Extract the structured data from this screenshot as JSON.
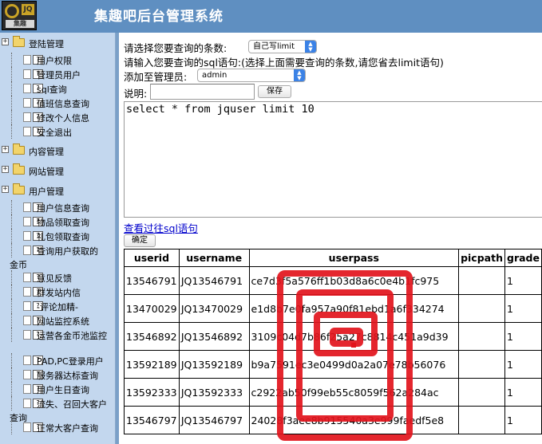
{
  "app": {
    "title": "集趣吧后台管理系统",
    "logo_badge": "JQ",
    "logo_sub": "集趣"
  },
  "sidebar": {
    "groups": [
      {
        "label": "登陆管理",
        "toggle": "+",
        "items": [
          "用户权限",
          "管理员用户",
          "sql查询",
          "值班信息查询",
          "修改个人信息",
          "安全退出"
        ]
      },
      {
        "label": "内容管理",
        "toggle": "+"
      },
      {
        "label": "网站管理",
        "toggle": "+"
      },
      {
        "label": "用户管理",
        "toggle": "+",
        "items": [
          "用户信息查询",
          "物品领取查询",
          "礼包领取查询",
          "查询用户获取的金币",
          "意见反馈",
          "群发站内信",
          "-评论加精-",
          "网站监控系统",
          "运营各金币池监控",
          "PAD,PC登录用户",
          "服务器达标查询",
          "用户生日查询",
          "流失、召回大客户查询",
          "正常大客户查询"
        ]
      }
    ]
  },
  "main": {
    "count_label": "请选择您要查询的条数:",
    "count_select": "自己写limit",
    "sql_label": "请输入您要查询的sql语句:(选择上面需要查询的条数,请您省去limit语句)",
    "admin_label": "添加至管理员:",
    "admin_select": "admin",
    "desc_label": "说明:",
    "desc_value": "",
    "save_label": "保存",
    "sql_text": "select * from jquser limit 10",
    "history_link": "查看过往sql语句",
    "confirm_label": "确定"
  },
  "table": {
    "columns": [
      "userid",
      "username",
      "userpass",
      "picpath",
      "grade"
    ],
    "rows": [
      [
        "13546791",
        "JQ13546791",
        "ce7d3f5a576ff1b03d8a6c0e4b1fc975",
        "",
        "1"
      ],
      [
        "13470029",
        "JQ13470029",
        "e1d8b7e0fa957a90f81ebd1a6f334274",
        "",
        "1"
      ],
      [
        "13546892",
        "JQ13546892",
        "3109c04d7b86f25a27c8814c451a9d39",
        "",
        "1"
      ],
      [
        "13592189",
        "JQ13592189",
        "b9a7591ec3e0499d0a2a07e78b56076",
        "",
        "1"
      ],
      [
        "13592333",
        "JQ13592333",
        "c2922ab50f99eb55c8059f562a284ac",
        "",
        "1"
      ],
      [
        "13546797",
        "JQ13546797",
        "24028f3aee8b915540a3e999faedf5e8",
        "",
        "1"
      ]
    ]
  }
}
